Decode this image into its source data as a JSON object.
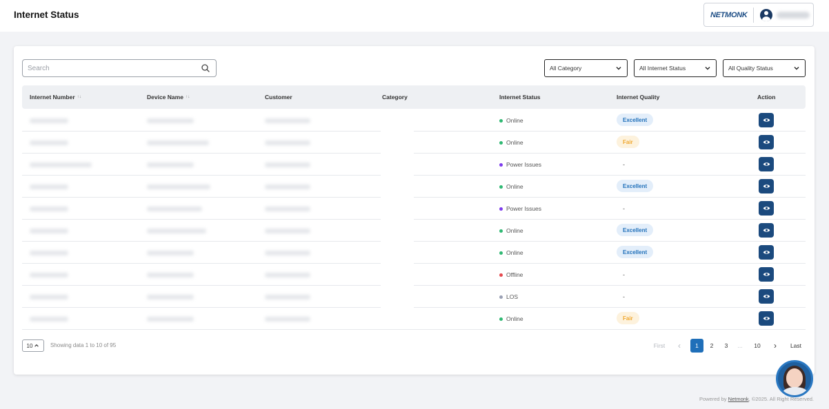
{
  "header": {
    "title": "Internet Status",
    "brand": "NETMONK",
    "user_avatar_icon": "user-circle-icon"
  },
  "filters": {
    "search_placeholder": "Search",
    "search_icon": "search-icon",
    "category": "All Category",
    "internet_status": "All Internet Status",
    "quality_status": "All Quality Status"
  },
  "table": {
    "columns": [
      "Internet Number",
      "Device Name",
      "Customer",
      "Category",
      "Internet Status",
      "Internet Quality",
      "Action"
    ],
    "sort_glyph": "↑↓",
    "rows": [
      {
        "status": "Online",
        "status_color": "#2eb872",
        "quality": "Excellent"
      },
      {
        "status": "Online",
        "status_color": "#2eb872",
        "quality": "Fair"
      },
      {
        "status": "Power Issues",
        "status_color": "#7c3aed",
        "quality": "-"
      },
      {
        "status": "Online",
        "status_color": "#2eb872",
        "quality": "Excellent"
      },
      {
        "status": "Power Issues",
        "status_color": "#7c3aed",
        "quality": "-"
      },
      {
        "status": "Online",
        "status_color": "#2eb872",
        "quality": "Excellent"
      },
      {
        "status": "Online",
        "status_color": "#2eb872",
        "quality": "Excellent"
      },
      {
        "status": "Offline",
        "status_color": "#e5484d",
        "quality": "-"
      },
      {
        "status": "LOS",
        "status_color": "#9aa0b4",
        "quality": "-"
      },
      {
        "status": "Online",
        "status_color": "#2eb872",
        "quality": "Fair"
      }
    ]
  },
  "quality_styles": {
    "Excellent": {
      "bg": "#e3eefa",
      "fg": "#1f6fb9"
    },
    "Fair": {
      "bg": "#fdf2dd",
      "fg": "#f0a830"
    }
  },
  "pagination": {
    "page_size": "10",
    "page_size_icon": "chevron-up-icon",
    "showing": "Showing data 1 to 10 of 95",
    "first": "First",
    "prev": "‹",
    "pages": [
      "1",
      "2",
      "3",
      "...",
      "10"
    ],
    "current": "1",
    "next": "›",
    "last": "Last"
  },
  "footer": {
    "prefix": "Powered by ",
    "link": "Netmonk",
    "suffix": ", ©2025. All Right Reserved."
  },
  "colors": {
    "primary": "#1b4a7e",
    "active_page": "#1f6fb9"
  }
}
